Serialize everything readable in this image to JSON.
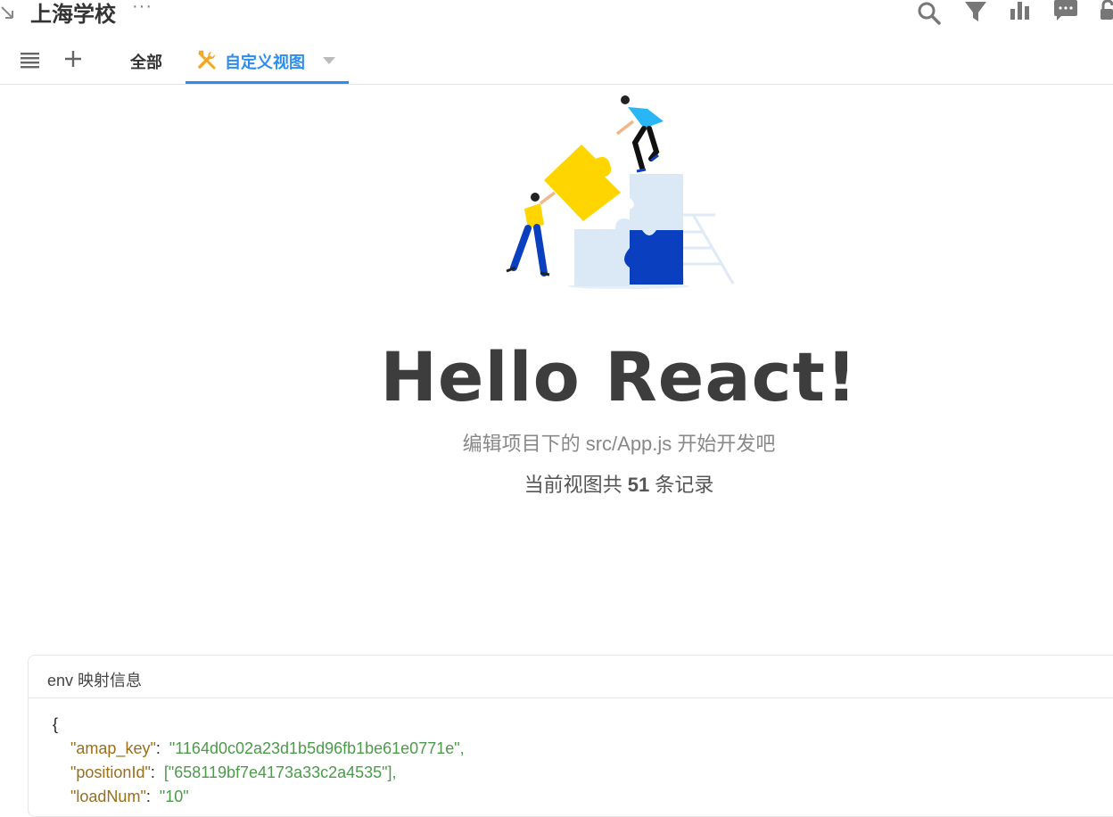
{
  "header": {
    "title": "上海学校",
    "more": "···"
  },
  "tabs": {
    "all_label": "全部",
    "custom_label": "自定义视图"
  },
  "main": {
    "heading": "Hello React!",
    "hint": "编辑项目下的 src/App.js 开始开发吧",
    "count_prefix": "当前视图共",
    "count_value": "51",
    "count_suffix": "条记录"
  },
  "env_card": {
    "title": "env 映射信息",
    "open_brace": "{",
    "entries": [
      {
        "key": "\"amap_key\"",
        "value": "\"1164d0c02a23d1b5d96fb1be61e0771e\","
      },
      {
        "key": "\"positionId\"",
        "value": "[\"658119bf7e4173a33c2a4535\"],"
      },
      {
        "key": "\"loadNum\"",
        "value": "\"10\""
      }
    ]
  },
  "colors": {
    "accent": "#2d8cf0",
    "wrench": "#f5a623",
    "heading": "#3d3d3d"
  }
}
